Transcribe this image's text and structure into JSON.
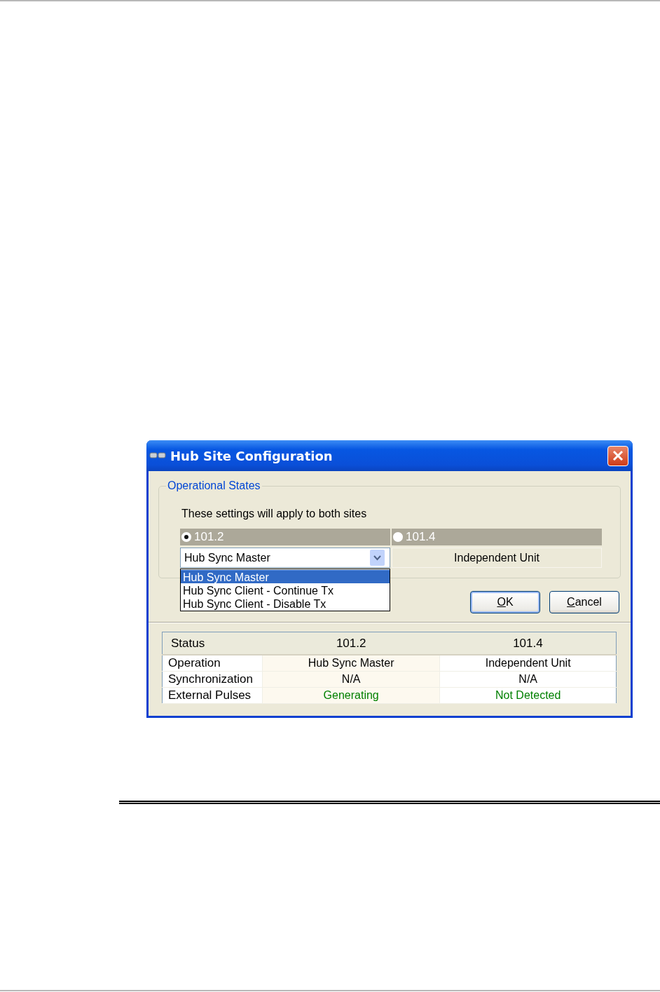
{
  "window": {
    "title": "Hub Site Configuration"
  },
  "group": {
    "title": "Operational States",
    "note": "These settings will apply to both sites",
    "sites": [
      {
        "label": "101.2",
        "selected": true,
        "kind": "combo",
        "value": "Hub Sync Master",
        "expanded": true,
        "options": [
          {
            "label": "Hub Sync Master",
            "selected": true
          },
          {
            "label": "Hub Sync Client - Continue Tx",
            "selected": false
          },
          {
            "label": "Hub Sync Client - Disable Tx",
            "selected": false
          }
        ]
      },
      {
        "label": "101.4",
        "selected": false,
        "kind": "text",
        "value": "Independent Unit"
      }
    ]
  },
  "buttons": [
    {
      "label": "OK",
      "default": true
    },
    {
      "label": "Cancel",
      "default": false
    }
  ],
  "status_table": {
    "columns": [
      "Status",
      "101.2",
      "101.4"
    ],
    "rows": [
      {
        "cells": [
          "Operation",
          "Hub Sync Master",
          "Independent Unit"
        ],
        "color": "#000000"
      },
      {
        "cells": [
          "Synchronization",
          "N/A",
          "N/A"
        ],
        "color": "#000000"
      },
      {
        "cells": [
          "External Pulses",
          "Generating",
          "Not Detected"
        ],
        "color": "#008000"
      }
    ]
  }
}
